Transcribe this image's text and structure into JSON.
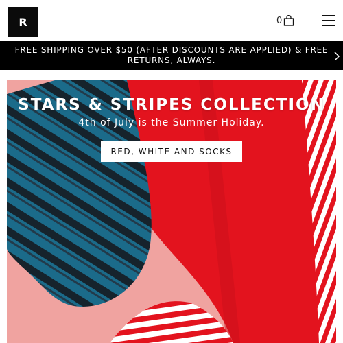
{
  "header": {
    "logo_text": "R",
    "logo_icon": "brand-logo",
    "cart_count": "0",
    "cart_icon": "shopping-bag-icon",
    "menu_icon": "hamburger-menu-icon"
  },
  "banner": {
    "text": "FREE SHIPPING OVER $50 (AFTER DISCOUNTS ARE APPLIED) & FREE RETURNS, ALWAYS.",
    "next_icon": "chevron-right-icon"
  },
  "hero": {
    "title": "STARS & STRIPES COLLECTION",
    "subtitle": "4th of July is the Summer Holiday.",
    "cta_label": "RED, WHITE AND SOCKS"
  },
  "colors": {
    "header_bg": "#ffffff",
    "banner_bg": "#000000",
    "hero_bg": "#f0a3a0",
    "sock_red": "#e3131e",
    "sock_blue": "#1b6b8a",
    "sock_dark": "#16232c"
  }
}
